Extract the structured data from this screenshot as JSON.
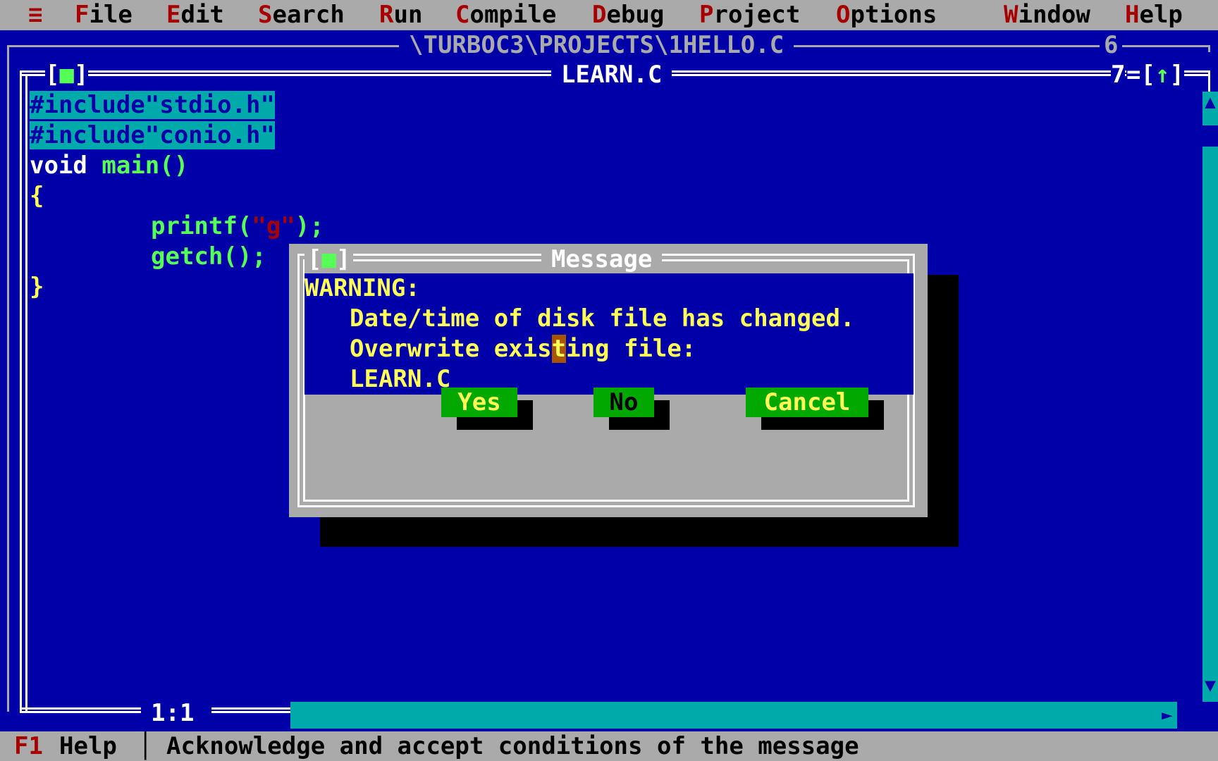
{
  "menu": {
    "system_icon": "≡",
    "items": [
      {
        "hotkey": "F",
        "rest": "ile"
      },
      {
        "hotkey": "E",
        "rest": "dit"
      },
      {
        "hotkey": "S",
        "rest": "earch"
      },
      {
        "hotkey": "R",
        "rest": "un"
      },
      {
        "hotkey": "C",
        "rest": "ompile"
      },
      {
        "hotkey": "D",
        "rest": "ebug"
      },
      {
        "hotkey": "P",
        "rest": "roject"
      },
      {
        "hotkey": "O",
        "rest": "ptions"
      },
      {
        "hotkey": "W",
        "rest": "indow"
      },
      {
        "hotkey": "H",
        "rest": "elp"
      }
    ]
  },
  "back_window": {
    "title": "\\TURBOC3\\PROJECTS\\1HELLO.C",
    "number": "6"
  },
  "editor": {
    "title": "LEARN.C",
    "number": "7",
    "close_box": "[■]",
    "zoom_box": "[↑]",
    "position": "1:1",
    "code": {
      "l1": "#include\"stdio.h\"",
      "l2": "#include\"conio.h\"",
      "l3_type": "void",
      "l3_rest": " main()",
      "l4": "{",
      "l5_fn": "printf(",
      "l5_str": "\"g\"",
      "l5_end": ");",
      "l6": "getch();",
      "l7": "}"
    }
  },
  "dialog": {
    "close_box": "[■]",
    "title": "Message",
    "warning": "WARNING:",
    "line1": "Date/time of disk file has changed.",
    "line2_a": "Overwrite exis",
    "line2_cursor": "t",
    "line2_b": "ing file:",
    "line3": "LEARN.C",
    "buttons": {
      "yes": "Yes",
      "no": "No",
      "cancel": "Cancel"
    }
  },
  "status": {
    "key": "F1",
    "key_label": "Help",
    "separator": "│",
    "hint": "Acknowledge and accept conditions of the message"
  },
  "colors": {
    "desktop": "#0000a8",
    "menu": "#aaaaaa",
    "hotkey": "#a80000",
    "text_yellow": "#ffff55",
    "highlight": "#00aaaa",
    "button": "#00a800"
  }
}
